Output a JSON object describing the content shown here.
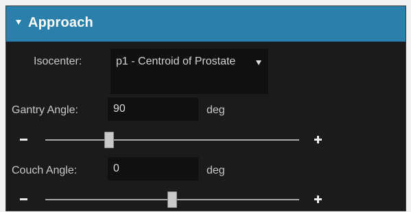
{
  "section": {
    "title": "Approach",
    "expanded": true
  },
  "isocenter": {
    "label": "Isocenter:",
    "value": "p1 - Centroid of Prostate"
  },
  "gantry": {
    "label": "Gantry Angle:",
    "value": "90",
    "unit": "deg",
    "slider_fraction": 0.25
  },
  "couch": {
    "label": "Couch Angle:",
    "value": "0",
    "unit": "deg",
    "slider_fraction": 0.5
  },
  "colors": {
    "header": "#2a7fab",
    "panel": "#1b1b1b",
    "field": "#101010"
  },
  "icons": {
    "collapse": "triangle-down-icon",
    "dropdown": "triangle-down-icon",
    "decrement": "minus-icon",
    "increment": "plus-icon"
  }
}
